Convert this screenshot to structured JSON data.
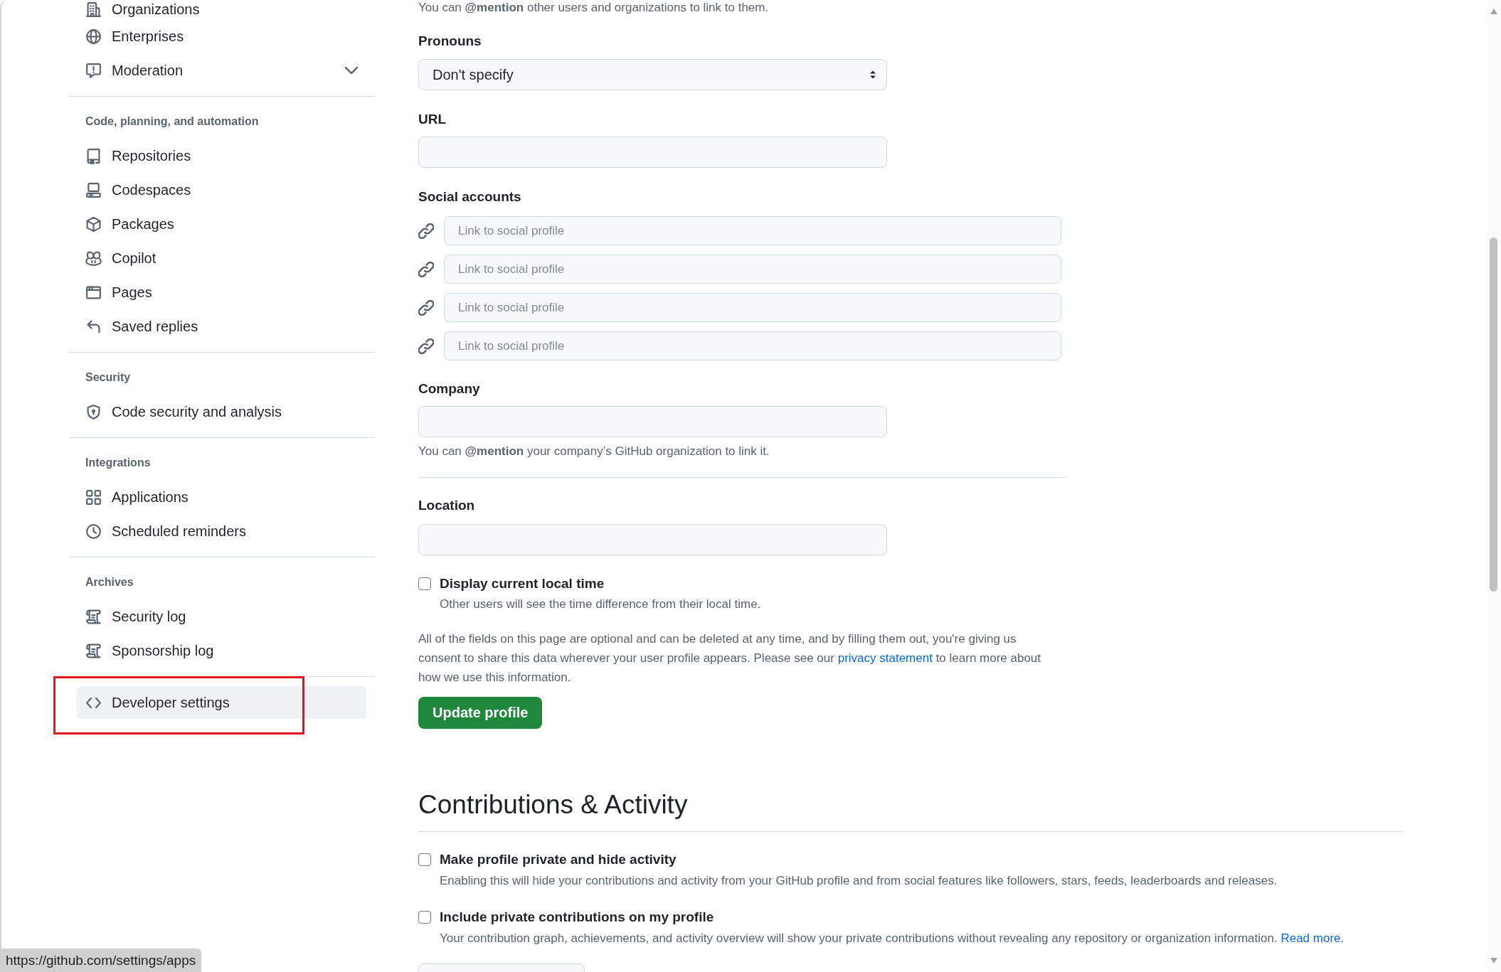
{
  "sidebar": {
    "sections": [
      {
        "framed": false,
        "items": [
          {
            "label": "Organizations",
            "kind": "link",
            "selected": false
          },
          {
            "label": "Enterprises",
            "kind": "link",
            "selected": false
          },
          {
            "label": "Moderation",
            "kind": "collapsible",
            "expanded": false,
            "selected": false
          }
        ]
      },
      {
        "heading": "Code, planning, and automation",
        "framed": false,
        "items": [
          {
            "label": "Repositories",
            "kind": "link",
            "selected": false
          },
          {
            "label": "Codespaces",
            "kind": "link",
            "selected": false
          },
          {
            "label": "Packages",
            "kind": "link",
            "selected": false
          },
          {
            "label": "Copilot",
            "kind": "link",
            "selected": false
          },
          {
            "label": "Pages",
            "kind": "link",
            "selected": false
          },
          {
            "label": "Saved replies",
            "kind": "link",
            "selected": false
          }
        ]
      },
      {
        "heading": "Security",
        "framed": false,
        "items": [
          {
            "label": "Code security and analysis",
            "kind": "link",
            "selected": false
          }
        ]
      },
      {
        "heading": "Integrations",
        "framed": false,
        "items": [
          {
            "label": "Applications",
            "kind": "link",
            "selected": false
          },
          {
            "label": "Scheduled reminders",
            "kind": "link",
            "selected": false
          }
        ]
      },
      {
        "heading": "Archives",
        "framed": false,
        "items": [
          {
            "label": "Security log",
            "kind": "link",
            "selected": false
          },
          {
            "label": "Sponsorship log",
            "kind": "link",
            "selected": false
          }
        ]
      },
      {
        "framed": true,
        "items": [
          {
            "label": "Developer settings",
            "kind": "link",
            "selected": true
          }
        ]
      }
    ]
  },
  "profile": {
    "mention_note": "You can **@mention** other users and organizations to link to them.",
    "pronouns": {
      "label": "Pronouns",
      "value": "Don't specify"
    },
    "url": {
      "label": "URL"
    },
    "social_accounts": {
      "label": "Social accounts",
      "fields": [
        {
          "placeholder": "Link to social profile"
        },
        {
          "placeholder": "Link to social profile"
        },
        {
          "placeholder": "Link to social profile"
        },
        {
          "placeholder": "Link to social profile"
        }
      ]
    },
    "company": {
      "label": "Company",
      "note": "You can **@mention** your company’s GitHub organization to link it."
    },
    "location": {
      "label": "Location"
    },
    "local_time": {
      "label": "Display current local time",
      "checked": false,
      "note": "Other users will see the time difference from their local time."
    },
    "privacy_note": {
      "before": "All of the fields on this page are optional and can be deleted at any time, and by filling them out, you're giving us consent to share this data wherever your user profile appears. Please see our",
      "link": "privacy statement",
      "after": "to learn more about how we use this information."
    },
    "submit_button": "Update profile"
  },
  "contributions": {
    "title": "Contributions & Activity",
    "options": [
      {
        "label": "Make profile private and hide activity",
        "checked": false,
        "note": "Enabling this will hide your contributions and activity from your GitHub profile and from social features like followers, stars, feeds, leaderboards and releases."
      },
      {
        "label": "Include private contributions on my profile",
        "checked": false,
        "note": "Your contribution graph, achievements, and activity overview will show your private contributions without revealing any repository or organization information.",
        "link": "Read more."
      }
    ]
  },
  "status_bar": {
    "url": "https://github.com/settings/apps"
  }
}
